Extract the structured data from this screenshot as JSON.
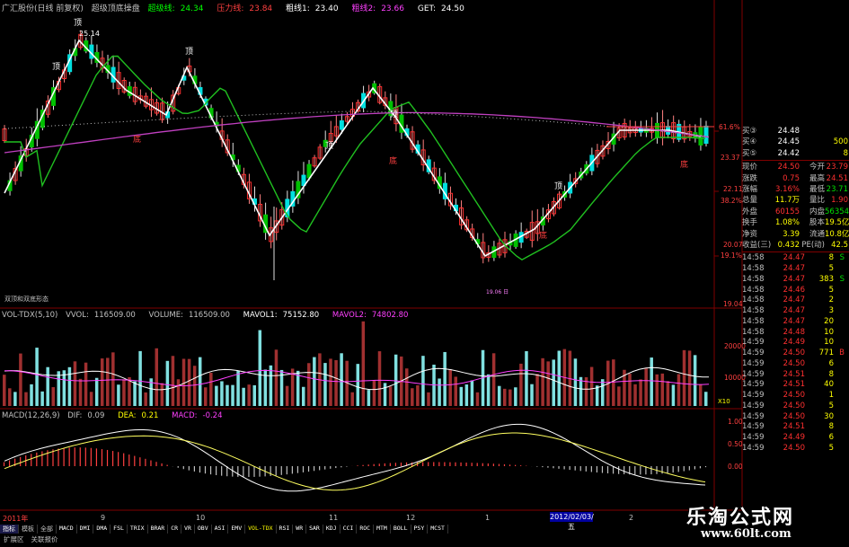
{
  "header": {
    "stock_title": "广汇股份(日线 前复权)",
    "indicator_name": "超级顶底操盘",
    "support_label": "超级线:",
    "support_value": "24.34",
    "pressure_label": "压力线:",
    "pressure_value": "23.84",
    "ma1_label": "粗线1:",
    "ma1_value": "23.40",
    "ma2_label": "粗线2:",
    "ma2_value": "23.66",
    "get_label": "GET:",
    "get_value": "24.50"
  },
  "price_axis": {
    "labels": [
      "25.14",
      "23.37",
      "22.11",
      "20.07",
      "19.04"
    ],
    "pct_labels": [
      "61.6%",
      "38.2%",
      "19.1%"
    ]
  },
  "annotations": {
    "high_label": "25.14",
    "top_markers": [
      "顶",
      "顶",
      "顶",
      "顶",
      "顶",
      "顶"
    ],
    "bottom_markers": [
      "底",
      "底",
      "底",
      "底"
    ],
    "info_text": "双顶和双底形态",
    "bottom_small": "19.06 日"
  },
  "volume_pane": {
    "title": "VOL-TDX(5,10)",
    "vvol_label": "VVOL:",
    "vvol_value": "116509.00",
    "volume_label": "VOLUME:",
    "volume_value": "116509.00",
    "mavol1_label": "MAVOL1:",
    "mavol1_value": "75152.80",
    "mavol2_label": "MAVOL2:",
    "mavol2_value": "74802.80",
    "axis": [
      "20000",
      "10000",
      "X10"
    ]
  },
  "macd_pane": {
    "title": "MACD(12,26,9)",
    "dif_label": "DIF:",
    "dif_value": "0.09",
    "dea_label": "DEA:",
    "dea_value": "0.21",
    "macd_label": "MACD:",
    "macd_value": "-0.24",
    "axis": [
      "1.00",
      "0.50",
      "0.00"
    ]
  },
  "quote_panel": {
    "rows": [
      {
        "name": "买③",
        "price": "24.48",
        "vol": "",
        "color": "#ffffff"
      },
      {
        "name": "买④",
        "price": "24.45",
        "vol": "500",
        "color": "#ffffff"
      },
      {
        "name": "买⑤",
        "price": "24.42",
        "vol": "8",
        "color": "#ffffff"
      }
    ],
    "stats": [
      {
        "k1": "现价",
        "v1": "24.50",
        "k2": "今开",
        "v2": "23.79",
        "c1": "#ff3030",
        "c2": "#ff3030"
      },
      {
        "k1": "涨跌",
        "v1": "0.75",
        "k2": "最高",
        "v2": "24.51",
        "c1": "#ff3030",
        "c2": "#ff3030"
      },
      {
        "k1": "涨幅",
        "v1": "3.16%",
        "k2": "最低",
        "v2": "23.71",
        "c1": "#ff3030",
        "c2": "#00e000"
      },
      {
        "k1": "总量",
        "v1": "11.7万",
        "k2": "量比",
        "v2": "1.90",
        "c1": "#ffff00",
        "c2": "#ff3030"
      },
      {
        "k1": "外盘",
        "v1": "60155",
        "k2": "内盘",
        "v2": "56354",
        "c1": "#ff3030",
        "c2": "#00e000"
      },
      {
        "k1": "换手",
        "v1": "1.08%",
        "k2": "股本",
        "v2": "19.5亿",
        "c1": "#ffff00",
        "c2": "#ffff00"
      },
      {
        "k1": "净资",
        "v1": "3.39",
        "k2": "流通",
        "v2": "10.8亿",
        "c1": "#ffff00",
        "c2": "#ffff00"
      },
      {
        "k1": "收益(三)",
        "v1": "0.432",
        "k2": "PE(动)",
        "v2": "42.5",
        "c1": "#ffff00",
        "c2": "#ffff00"
      }
    ],
    "ticks": [
      {
        "t": "14:58",
        "p": "24.47",
        "v": "8",
        "d": "S",
        "pc": "#ff3030",
        "vc": "#00e000"
      },
      {
        "t": "14:58",
        "p": "24.47",
        "v": "5",
        "d": "",
        "pc": "#ff3030",
        "vc": "#ff3030"
      },
      {
        "t": "14:58",
        "p": "24.47",
        "v": "383",
        "d": "S",
        "pc": "#ff3030",
        "vc": "#00e000"
      },
      {
        "t": "14:58",
        "p": "24.46",
        "v": "5",
        "d": "",
        "pc": "#ff3030",
        "vc": "#ff3030"
      },
      {
        "t": "14:58",
        "p": "24.47",
        "v": "2",
        "d": "",
        "pc": "#ff3030",
        "vc": "#ff3030"
      },
      {
        "t": "14:58",
        "p": "24.47",
        "v": "3",
        "d": "",
        "pc": "#ff3030",
        "vc": "#ff3030"
      },
      {
        "t": "14:58",
        "p": "24.47",
        "v": "20",
        "d": "",
        "pc": "#ff3030",
        "vc": "#ff3030"
      },
      {
        "t": "14:58",
        "p": "24.48",
        "v": "10",
        "d": "",
        "pc": "#ff3030",
        "vc": "#ff3030"
      },
      {
        "t": "14:59",
        "p": "24.49",
        "v": "10",
        "d": "",
        "pc": "#ff3030",
        "vc": "#ff3030"
      },
      {
        "t": "14:59",
        "p": "24.50",
        "v": "771",
        "d": "B",
        "pc": "#ff3030",
        "vc": "#ff3030"
      },
      {
        "t": "14:59",
        "p": "24.50",
        "v": "6",
        "d": "",
        "pc": "#ff3030",
        "vc": "#ff3030"
      },
      {
        "t": "14:59",
        "p": "24.51",
        "v": "8",
        "d": "",
        "pc": "#ff3030",
        "vc": "#ff3030"
      },
      {
        "t": "14:59",
        "p": "24.51",
        "v": "40",
        "d": "",
        "pc": "#ff3030",
        "vc": "#ff3030"
      },
      {
        "t": "14:59",
        "p": "24.50",
        "v": "1",
        "d": "",
        "pc": "#ff3030",
        "vc": "#ff3030"
      },
      {
        "t": "14:59",
        "p": "24.50",
        "v": "5",
        "d": "",
        "pc": "#ff3030",
        "vc": "#ff3030"
      },
      {
        "t": "14:59",
        "p": "24.50",
        "v": "30",
        "d": "",
        "pc": "#ff3030",
        "vc": "#ff3030"
      },
      {
        "t": "14:59",
        "p": "24.51",
        "v": "8",
        "d": "",
        "pc": "#ff3030",
        "vc": "#ff3030"
      },
      {
        "t": "14:59",
        "p": "24.49",
        "v": "6",
        "d": "",
        "pc": "#ff3030",
        "vc": "#ff3030"
      },
      {
        "t": "14:59",
        "p": "24.50",
        "v": "5",
        "d": "",
        "pc": "#ff3030",
        "vc": "#ff3030"
      }
    ]
  },
  "date_axis": {
    "labels": [
      "2011年",
      "9",
      "10",
      "11",
      "12",
      "1",
      "2"
    ],
    "selected_date": "2012/02/03/五"
  },
  "tabs": {
    "items": [
      "指标",
      "模板",
      "全部",
      "MACD",
      "DMI",
      "DMA",
      "FSL",
      "TRIX",
      "BRAR",
      "CR",
      "VR",
      "OBV",
      "ASI",
      "EMV",
      "VOL-TDX",
      "RSI",
      "WR",
      "SAR",
      "KDJ",
      "CCI",
      "ROC",
      "MTM",
      "BOLL",
      "PSY",
      "MCST"
    ]
  },
  "ext_row": {
    "items": [
      "扩展区",
      "关联报价"
    ]
  },
  "watermark": {
    "title": "乐淘公式网",
    "url": "www.60lt.com"
  },
  "colors": {
    "up": "#ff3030",
    "down": "#00e0e0",
    "green_line": "#20c020",
    "purple_line": "#c040c0",
    "white_line": "#ffffff",
    "axis": "#800000"
  }
}
